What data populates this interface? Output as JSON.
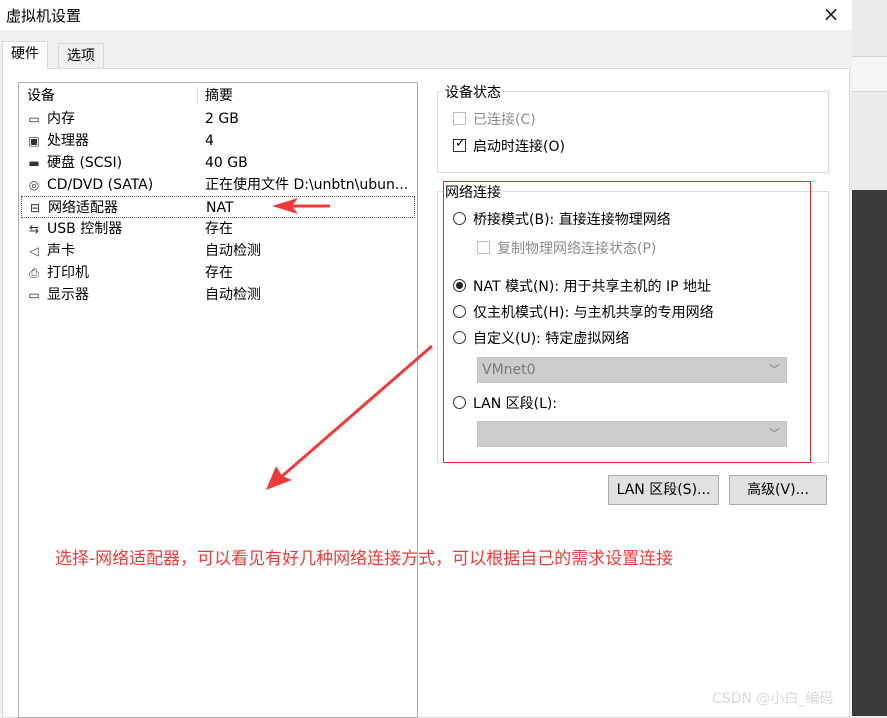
{
  "window": {
    "title": "虚拟机设置",
    "close_icon": "×"
  },
  "tabs": [
    {
      "label": "硬件"
    },
    {
      "label": "选项"
    }
  ],
  "device_list": {
    "col_device": "设备",
    "col_summary": "摘要",
    "rows": [
      {
        "icon": "memory-icon",
        "glyph": "▭",
        "name": "内存",
        "value": "2 GB"
      },
      {
        "icon": "cpu-icon",
        "glyph": "▣",
        "name": "处理器",
        "value": "4"
      },
      {
        "icon": "hard-disk-icon",
        "glyph": "▬",
        "name": "硬盘 (SCSI)",
        "value": "40 GB"
      },
      {
        "icon": "cd-dvd-icon",
        "glyph": "◎",
        "name": "CD/DVD (SATA)",
        "value": "正在使用文件 D:\\unbtn\\ubun..."
      },
      {
        "icon": "network-adapter-icon",
        "glyph": "⊟",
        "name": "网络适配器",
        "value": "NAT"
      },
      {
        "icon": "usb-icon",
        "glyph": "⇆",
        "name": "USB 控制器",
        "value": "存在"
      },
      {
        "icon": "sound-card-icon",
        "glyph": "◁",
        "name": "声卡",
        "value": "自动检测"
      },
      {
        "icon": "printer-icon",
        "glyph": "⎙",
        "name": "打印机",
        "value": "存在"
      },
      {
        "icon": "display-icon",
        "glyph": "▭",
        "name": "显示器",
        "value": "自动检测"
      }
    ]
  },
  "device_status": {
    "title": "设备状态",
    "connected": {
      "label": "已连接(C)",
      "checked": false,
      "enabled": false
    },
    "connect_at_power_on": {
      "label": "启动时连接(O)",
      "checked": true
    }
  },
  "network_connection": {
    "title": "网络连接",
    "bridged": "桥接模式(B): 直接连接物理网络",
    "replicate": "复制物理网络连接状态(P)",
    "nat": "NAT 模式(N): 用于共享主机的 IP 地址",
    "host_only": "仅主机模式(H): 与主机共享的专用网络",
    "custom": "自定义(U): 特定虚拟网络",
    "vmnet_value": "VMnet0",
    "lan_segment": "LAN 区段(L):",
    "lan_segment_value": "",
    "selected": "nat"
  },
  "buttons": {
    "lan_segments": "LAN 区段(S)...",
    "advanced": "高级(V)..."
  },
  "annotation": {
    "text": "选择-网络适配器，可以看见有好几种网络连接方式，可以根据自己的需求设置连接",
    "color": "#f03a3a"
  },
  "watermark": "CSDN @小白_编码"
}
